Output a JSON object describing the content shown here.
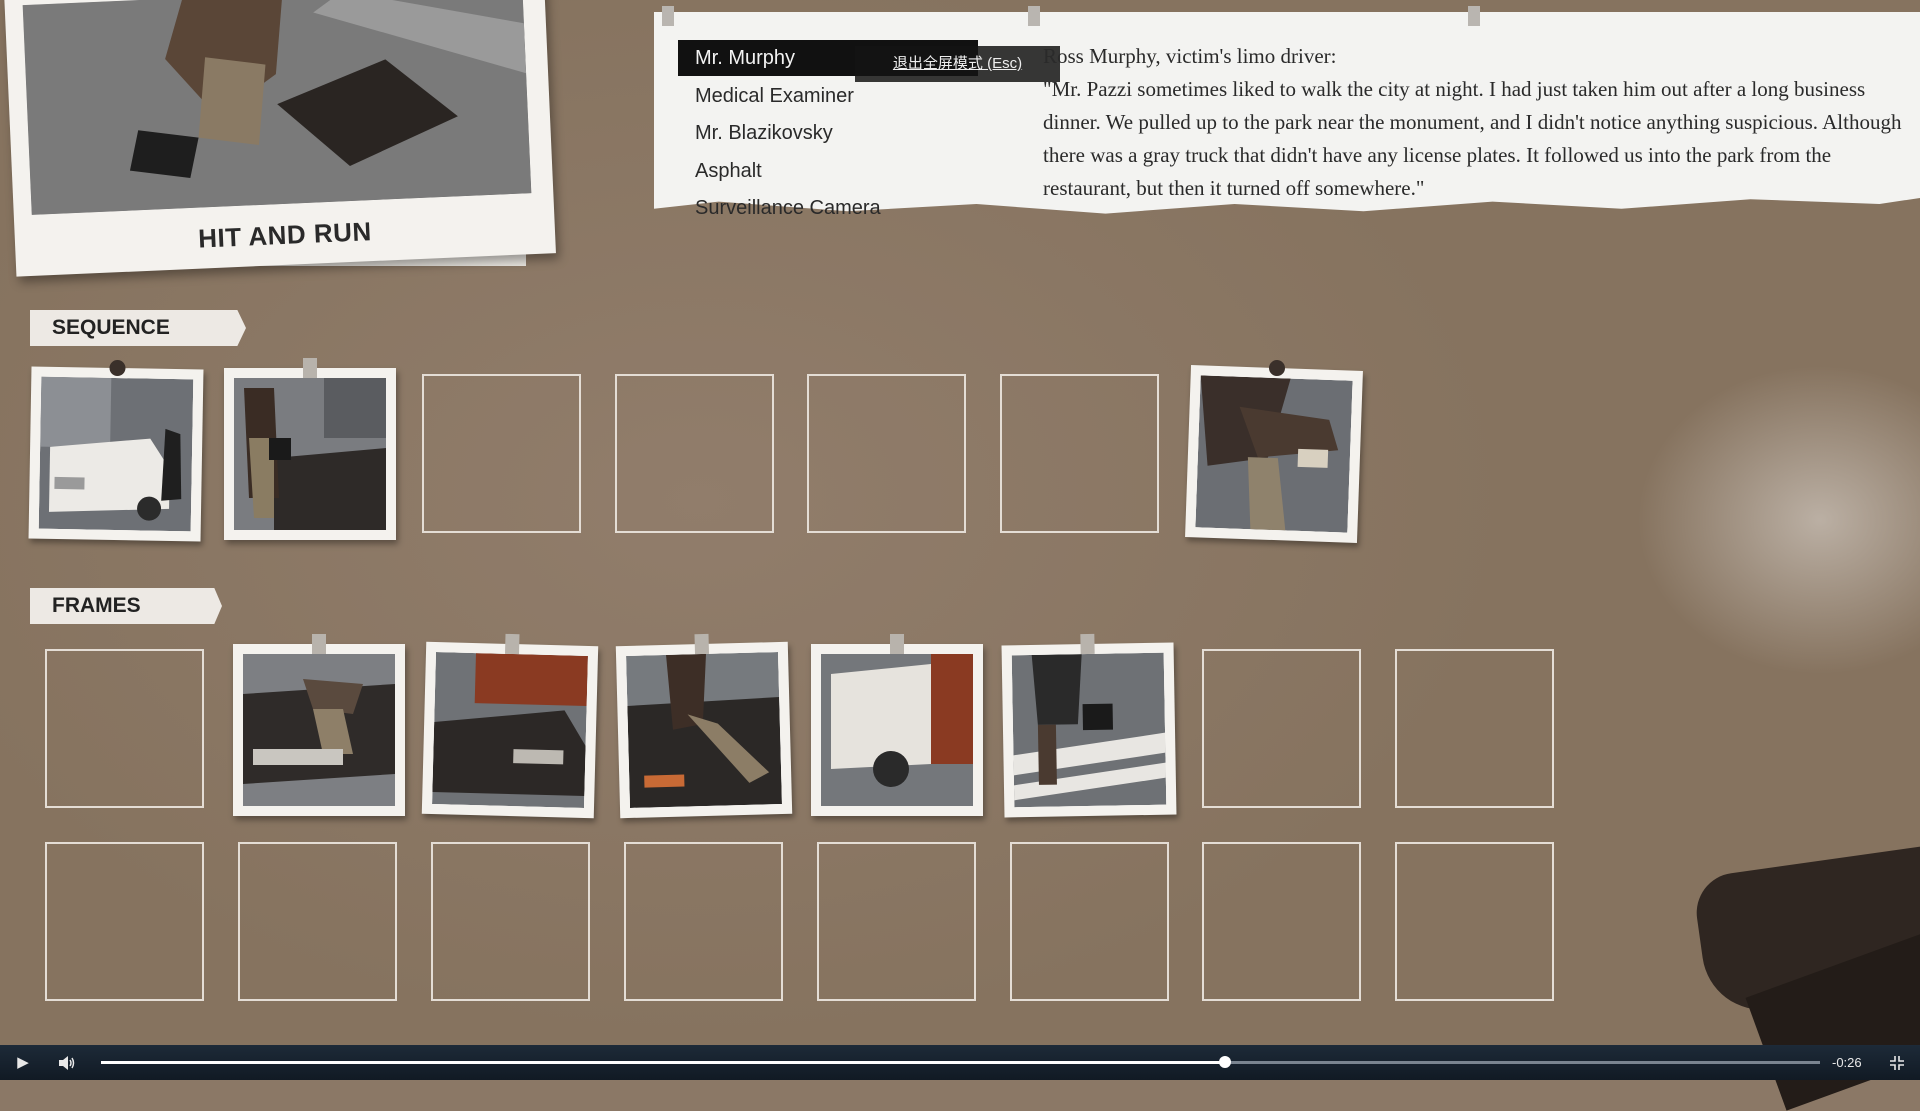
{
  "case": {
    "title": "HIT AND RUN"
  },
  "witnesses": {
    "items": [
      {
        "label": "Mr. Murphy",
        "selected": true
      },
      {
        "label": "Medical Examiner",
        "selected": false
      },
      {
        "label": "Mr. Blazikovsky",
        "selected": false
      },
      {
        "label": "Asphalt",
        "selected": false
      },
      {
        "label": "Surveillance Camera",
        "selected": false
      }
    ]
  },
  "fullscreen_tip": "退出全屏模式 (Esc)",
  "testimony": {
    "speaker": "Ross Murphy, victim's limo driver:",
    "quote": "\"Mr. Pazzi sometimes liked to walk the city at night. I had just taken him out after a long business dinner. We pulled up to the park near the monument, and I didn't notice anything suspicious. Although there was a gray truck that didn't have any license plates. It followed us into the park from the restaurant, but then it turned off somewhere.\""
  },
  "sequence": {
    "label": "SEQUENCE",
    "slots": [
      "white-limo-photo",
      "man-with-briefcase-photo",
      "empty",
      "empty",
      "empty",
      "empty",
      "victim-on-hood-photo"
    ]
  },
  "frames": {
    "label": "FRAMES",
    "row1": [
      "empty",
      "victim-on-car-photo",
      "dark-car-photo",
      "victim-falling-photo",
      "white-truck-photo",
      "walking-briefcase-photo",
      "empty",
      "empty"
    ],
    "row2": [
      "empty",
      "empty",
      "empty",
      "empty",
      "empty",
      "empty",
      "empty",
      "empty"
    ]
  },
  "video": {
    "time_remaining": "-0:26",
    "progress": 0.654,
    "icons": {
      "play": "play-icon",
      "volume": "volume-icon",
      "exit_fullscreen": "exit-fullscreen-icon"
    }
  },
  "colors": {
    "board": "#8b7866",
    "paper": "#f3f3f1",
    "selected": "#111111",
    "controls": "#1d2a38"
  }
}
